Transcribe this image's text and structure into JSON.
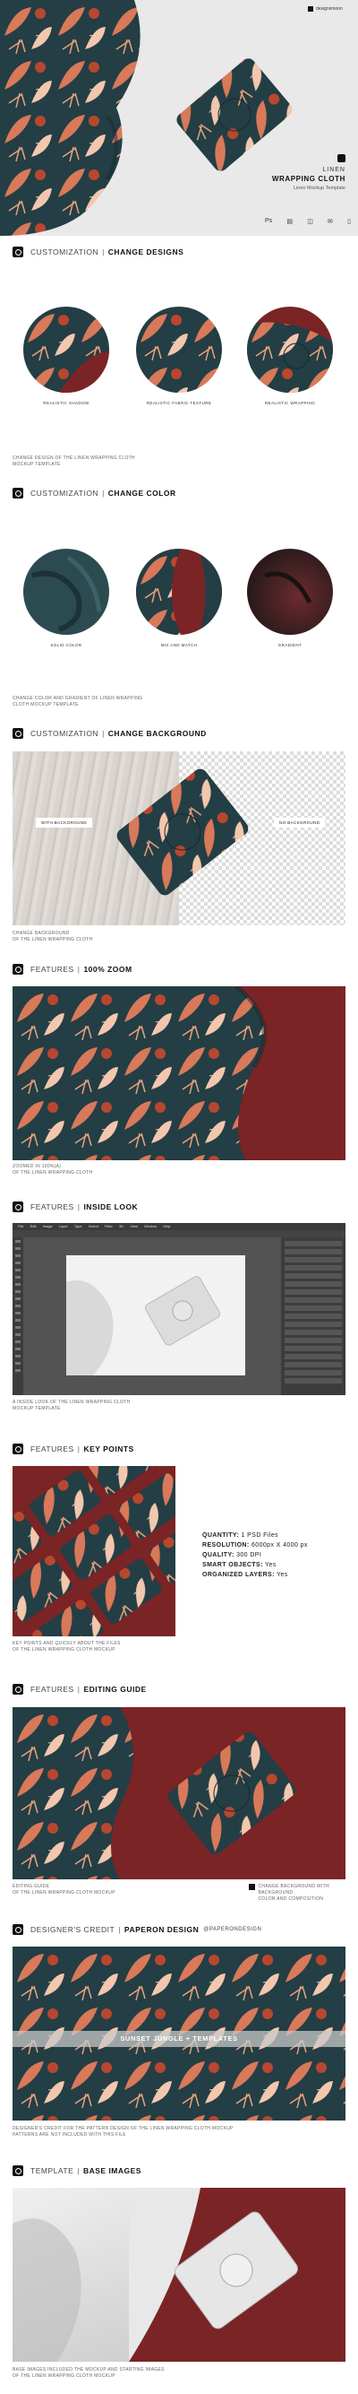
{
  "brand": "designsmoon",
  "hero": {
    "line1": "LINEN",
    "line2": "WRAPPING CLOTH",
    "line3": "Linen Mockup Template",
    "icons": [
      "photoshop-icon",
      "layers-icon",
      "box-icon",
      "mail-icon",
      "document-icon"
    ]
  },
  "sections": {
    "s1": {
      "thin": "CUSTOMIZATION",
      "bold": "CHANGE DESIGNS",
      "labels": [
        "REALISTIC SHADOW",
        "REALISTIC FABRIC TEXTURE",
        "REALISTIC WRAPPING"
      ],
      "caption": [
        "CHANGE DESIGN OF THE LINEN WRAPPING CLOTH",
        "MOCKUP TEMPLATE"
      ]
    },
    "s2": {
      "thin": "CUSTOMIZATION",
      "bold": "CHANGE COLOR",
      "labels": [
        "SOLID COLOR",
        "MIX AND MATCH",
        "GRADIENT"
      ],
      "caption": [
        "CHANGE COLOR AND GRADIENT OF LINEN WRAPPING",
        "CLOTH MOCKUP TEMPLATE"
      ]
    },
    "s3": {
      "thin": "CUSTOMIZATION",
      "bold": "CHANGE BACKGROUND",
      "badges": [
        "WITH BACKGROUND",
        "NO BACKGROUND"
      ],
      "caption": [
        "CHANGE BACKGROUND",
        "OF THE LINEN WRAPPING CLOTH"
      ]
    },
    "s4": {
      "thin": "FEATURES",
      "bold": "100% ZOOM",
      "caption": [
        "ZOOMED IN 100%(A)",
        "OF THE LINEN WRAPPING CLOTH"
      ]
    },
    "s5": {
      "thin": "FEATURES",
      "bold": "INSIDE LOOK",
      "caption": [
        "A INSIDE LOOK OF THE LINEN WRAPPING CLOTH",
        "MOCKUP TEMPLATE"
      ]
    },
    "s6": {
      "thin": "FEATURES",
      "bold": "KEY POINTS",
      "specs": [
        {
          "k": "QUANTITY:",
          "v": "1 PSD Files"
        },
        {
          "k": "RESOLUTION:",
          "v": "6000px X 4000 px"
        },
        {
          "k": "QUALITY:",
          "v": "300 DPI"
        },
        {
          "k": "SMART OBJECTS:",
          "v": "Yes"
        },
        {
          "k": "ORGANIZED LAYERS:",
          "v": "Yes"
        }
      ],
      "caption": [
        "KEY POINTS AND QUICKLY ABOUT THE FILES",
        "OF THE LINEN WRAPPING CLOTH MOCKUP"
      ]
    },
    "s7": {
      "thin": "FEATURES",
      "bold": "EDITING GUIDE",
      "caption_left": [
        "EDITING GUIDE",
        "OF THE LINEN WRAPPING CLOTH MOCKUP"
      ],
      "caption_right": [
        "CHANGE BACKGROUND WITH BACKGROUND",
        "COLOR AND COMPOSITION"
      ]
    },
    "s8": {
      "thin": "DESIGNER'S CREDIT",
      "bold": "PAPERON DESIGN",
      "handle": "@PAPERONDESIGN",
      "banner": "SUNSET JUNGLE + TEMPLATES",
      "caption": [
        "DESIGNER'S CREDIT FOR THE PATTERN DESIGN OF THE LINEN WRAPPING CLOTH MOCKUP",
        "PATTERNS ARE NOT INCLUDED WITH THIS FILE"
      ]
    },
    "s9": {
      "thin": "TEMPLATE",
      "bold": "BASE IMAGES",
      "caption": [
        "BASE IMAGES INCLUDED THE MOCKUP AND STARTING IMAGES",
        "OF THE LINEN WRAPPING CLOTH MOCKUP"
      ]
    }
  },
  "photoshop": {
    "menu": [
      "File",
      "Edit",
      "Image",
      "Layer",
      "Type",
      "Select",
      "Filter",
      "3D",
      "View",
      "Window",
      "Help"
    ]
  },
  "colors": {
    "teal": "#233e44",
    "maroon": "#7a2426",
    "coral": "#d8795a",
    "peach": "#f2c7ae"
  }
}
